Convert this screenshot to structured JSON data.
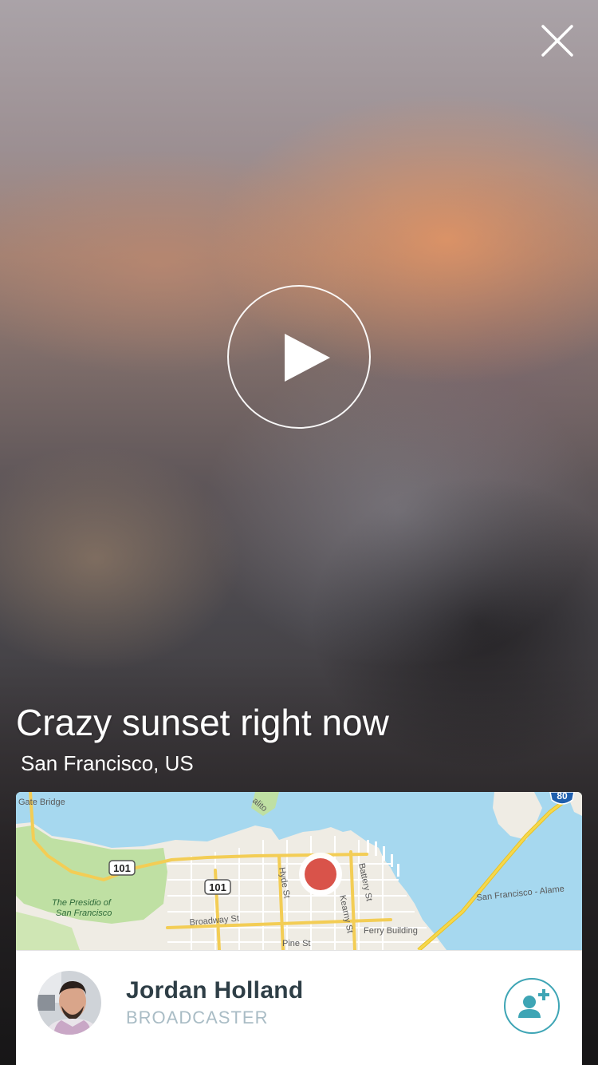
{
  "broadcast": {
    "title": "Crazy sunset right now",
    "location": "San Francisco, US"
  },
  "controls": {
    "close_icon": "close-icon",
    "play_icon": "play-icon"
  },
  "map": {
    "labels": {
      "gate_bridge": "Gate Bridge",
      "sausalito": "alito",
      "highway_101_a": "101",
      "highway_101_b": "101",
      "highway_80": "80",
      "presidio_line1": "The Presidio of",
      "presidio_line2": "San Francisco",
      "hyde_st": "Hyde St",
      "battery_st": "Battery St",
      "kearny_st": "Kearny St",
      "broadway_st": "Broadway St",
      "pine_st": "Pine St",
      "ferry_building": "Ferry Building",
      "bay_bridge": "San Francisco - Alame"
    },
    "marker_color": "#d9534a",
    "water_color": "#a6d8ef",
    "land_color": "#efece4",
    "park_color": "#bfe0a3"
  },
  "broadcaster": {
    "name": "Jordan Holland",
    "role": "BROADCASTER",
    "follow_icon": "add-user-icon"
  },
  "colors": {
    "accent": "#3ea5b5",
    "name_text": "#2e3e46",
    "role_text": "#a9bcc5"
  }
}
